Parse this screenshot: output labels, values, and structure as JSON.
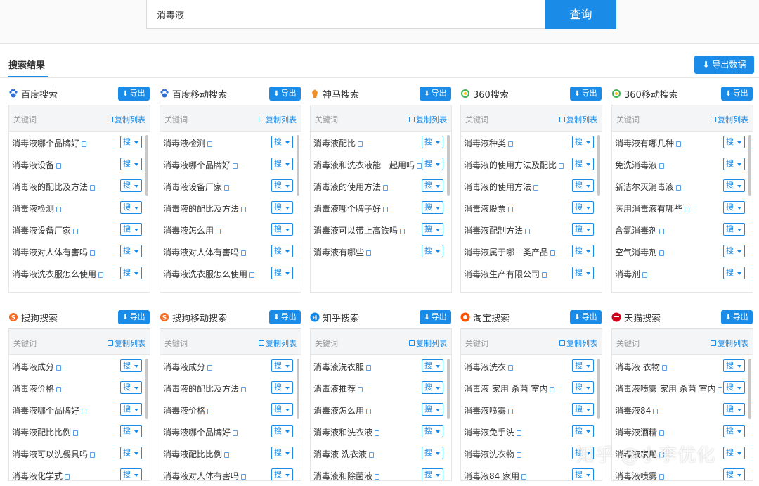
{
  "search": {
    "value": "消毒液",
    "button": "查询"
  },
  "results": {
    "title": "搜索结果",
    "export_all": "导出数据"
  },
  "common": {
    "export": "导出",
    "keyword_header": "关键词",
    "copy_list": "复制列表",
    "engine_select": "搜"
  },
  "engines": [
    {
      "name": "百度搜索",
      "icon": "baidu-paw-icon",
      "color": "#2f6fd6",
      "keywords": [
        "消毒液哪个品牌好",
        "消毒液设备",
        "消毒液的配比及方法",
        "消毒液检测",
        "消毒液设备厂家",
        "消毒液对人体有害吗",
        "消毒液洗衣服怎么使用"
      ]
    },
    {
      "name": "百度移动搜索",
      "icon": "baidu-paw-icon",
      "color": "#2f6fd6",
      "keywords": [
        "消毒液检测",
        "消毒液哪个品牌好",
        "消毒液设备厂家",
        "消毒液的配比及方法",
        "消毒液怎么用",
        "消毒液对人体有害吗",
        "消毒液洗衣服怎么使用"
      ]
    },
    {
      "name": "神马搜索",
      "icon": "shenma-icon",
      "color": "#f08c2a",
      "keywords": [
        "消毒液配比",
        "消毒液和洗衣液能一起用吗",
        "消毒液的使用方法",
        "消毒液哪个牌子好",
        "消毒液可以带上高铁吗",
        "消毒液有哪些"
      ]
    },
    {
      "name": "360搜索",
      "icon": "360-icon",
      "color": "#3cb44b",
      "keywords": [
        "消毒液种类",
        "消毒液的使用方法及配比",
        "消毒液的使用方法",
        "消毒液股票",
        "消毒液配制方法",
        "消毒液属于哪一类产品",
        "消毒液生产有限公司"
      ]
    },
    {
      "name": "360移动搜索",
      "icon": "360-icon",
      "color": "#3cb44b",
      "keywords": [
        "消毒液有哪几种",
        "免洗消毒液",
        "新洁尔灭消毒液",
        "医用消毒液有哪些",
        "含氯消毒剂",
        "空气消毒剂",
        "消毒剂"
      ]
    },
    {
      "name": "搜狗搜索",
      "icon": "sogou-icon",
      "color": "#f26b21",
      "keywords": [
        "消毒液成分",
        "消毒液价格",
        "消毒液哪个品牌好",
        "消毒液配比比例",
        "消毒液可以洗餐具吗",
        "消毒液化学式"
      ]
    },
    {
      "name": "搜狗移动搜索",
      "icon": "sogou-icon",
      "color": "#f26b21",
      "keywords": [
        "消毒液成分",
        "消毒液的配比及方法",
        "消毒液价格",
        "消毒液哪个品牌好",
        "消毒液配比比例",
        "消毒液对人体有害吗"
      ]
    },
    {
      "name": "知乎搜索",
      "icon": "zhihu-icon",
      "color": "#0f88eb",
      "keywords": [
        "消毒液洗衣服",
        "消毒液推荐",
        "消毒液怎么用",
        "消毒液和洗衣液",
        "消毒液 洗衣液",
        "消毒液和除菌液"
      ]
    },
    {
      "name": "淘宝搜索",
      "icon": "taobao-icon",
      "color": "#ff5000",
      "keywords": [
        "消毒液洗衣",
        "消毒液 家用 杀菌 室内",
        "消毒液喷雾",
        "消毒液免手洗",
        "消毒液洗衣物",
        "消毒液84 家用"
      ]
    },
    {
      "name": "天猫搜索",
      "icon": "tmall-icon",
      "color": "#d0021b",
      "keywords": [
        "消毒液 衣物",
        "消毒液喷雾 家用 杀菌 室内",
        "消毒液84",
        "消毒液酒精",
        "消毒液家用",
        "消毒液喷雾"
      ]
    }
  ],
  "watermark": "知乎 @小李优化"
}
